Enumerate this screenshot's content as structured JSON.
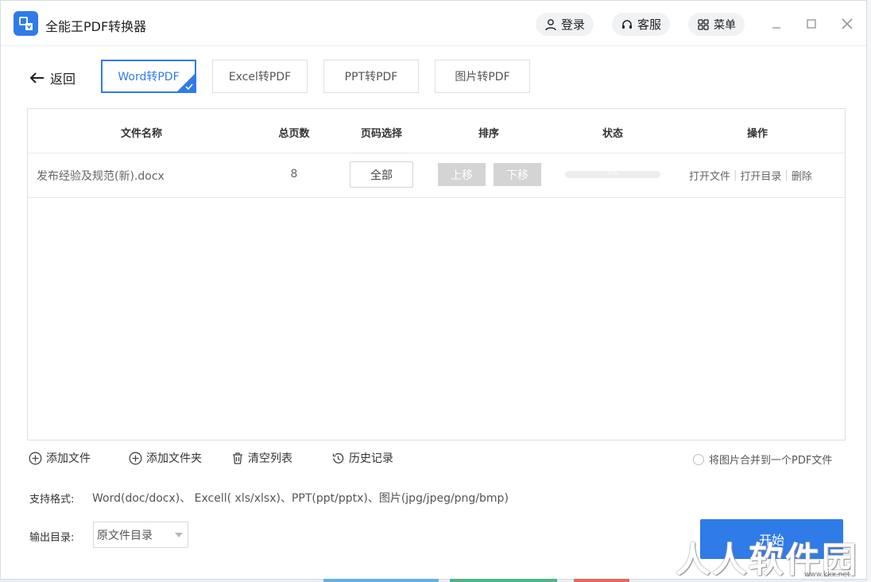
{
  "app": {
    "title": "全能王PDF转换器"
  },
  "header": {
    "login_label": "登录",
    "service_label": "客服",
    "menu_label": "菜单"
  },
  "nav": {
    "back_label": "返回"
  },
  "tabs": [
    {
      "label": "Word转PDF",
      "active": true
    },
    {
      "label": "Excel转PDF",
      "active": false
    },
    {
      "label": "PPT转PDF",
      "active": false
    },
    {
      "label": "图片转PDF",
      "active": false
    }
  ],
  "table": {
    "headers": {
      "name": "文件名称",
      "pages": "总页数",
      "page_select": "页码选择",
      "sort": "排序",
      "status": "状态",
      "actions": "操作"
    },
    "rows": [
      {
        "name": "发布经验及规范(新).docx",
        "pages": "8",
        "page_select": "全部",
        "move_up": "上移",
        "move_down": "下移",
        "progress": 0,
        "progress_text": "0%",
        "open_file": "打开文件",
        "open_dir": "打开目录",
        "delete": "删除"
      }
    ]
  },
  "actions": {
    "add_file": "添加文件",
    "add_folder": "添加文件夹",
    "clear_list": "清空列表",
    "history": "历史记录",
    "merge_images": "将图片合并到一个PDF文件"
  },
  "formats": {
    "label": "支持格式:",
    "value": "Word(doc/docx)、 Excell( xls/xlsx)、PPT(ppt/pptx)、图片(jpg/jpeg/png/bmp)"
  },
  "output": {
    "label": "输出目录:",
    "selected": "原文件目录"
  },
  "start_label": "开始",
  "watermark": {
    "text": "人人软件园",
    "sub": "www.kkx.net"
  },
  "colors": {
    "accent": "#2f7be7",
    "button_gray": "#d4d4d4"
  }
}
